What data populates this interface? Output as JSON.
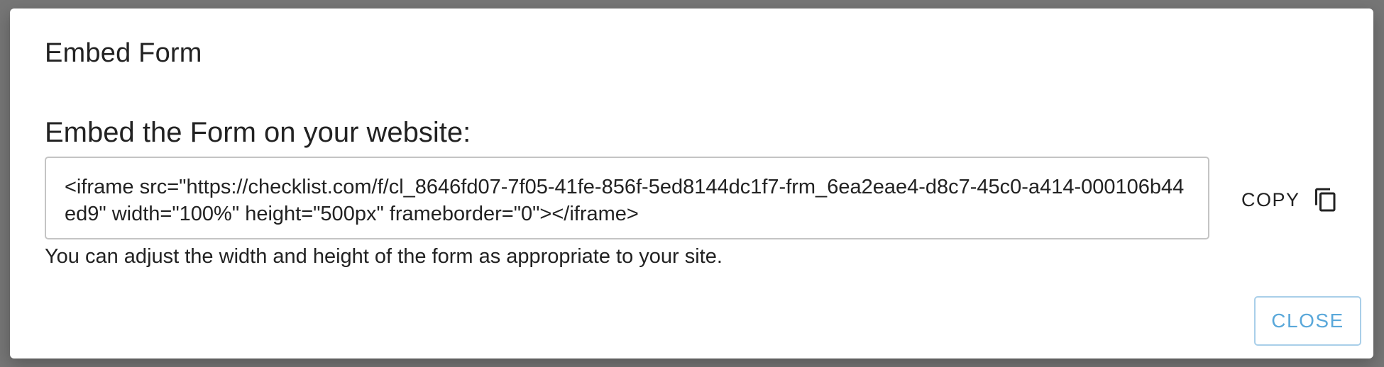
{
  "dialog": {
    "title": "Embed Form",
    "section_label": "Embed the Form on your website:",
    "embed_code": "<iframe src=\"https://checklist.com/f/cl_8646fd07-7f05-41fe-856f-5ed8144dc1f7-frm_6ea2eae4-d8c7-45c0-a414-000106b44ed9\" width=\"100%\" height=\"500px\" frameborder=\"0\"></iframe>",
    "hint": "You can adjust the width and height of the form as appropriate to your site.",
    "copy_label": "COPY",
    "copy_icon": "copy-icon",
    "close_label": "CLOSE"
  },
  "colors": {
    "overlay": "#767676",
    "accent": "#5aa8da",
    "accent_border": "#a9cfe9",
    "text": "#222222",
    "field_border": "#c4c4c4"
  }
}
